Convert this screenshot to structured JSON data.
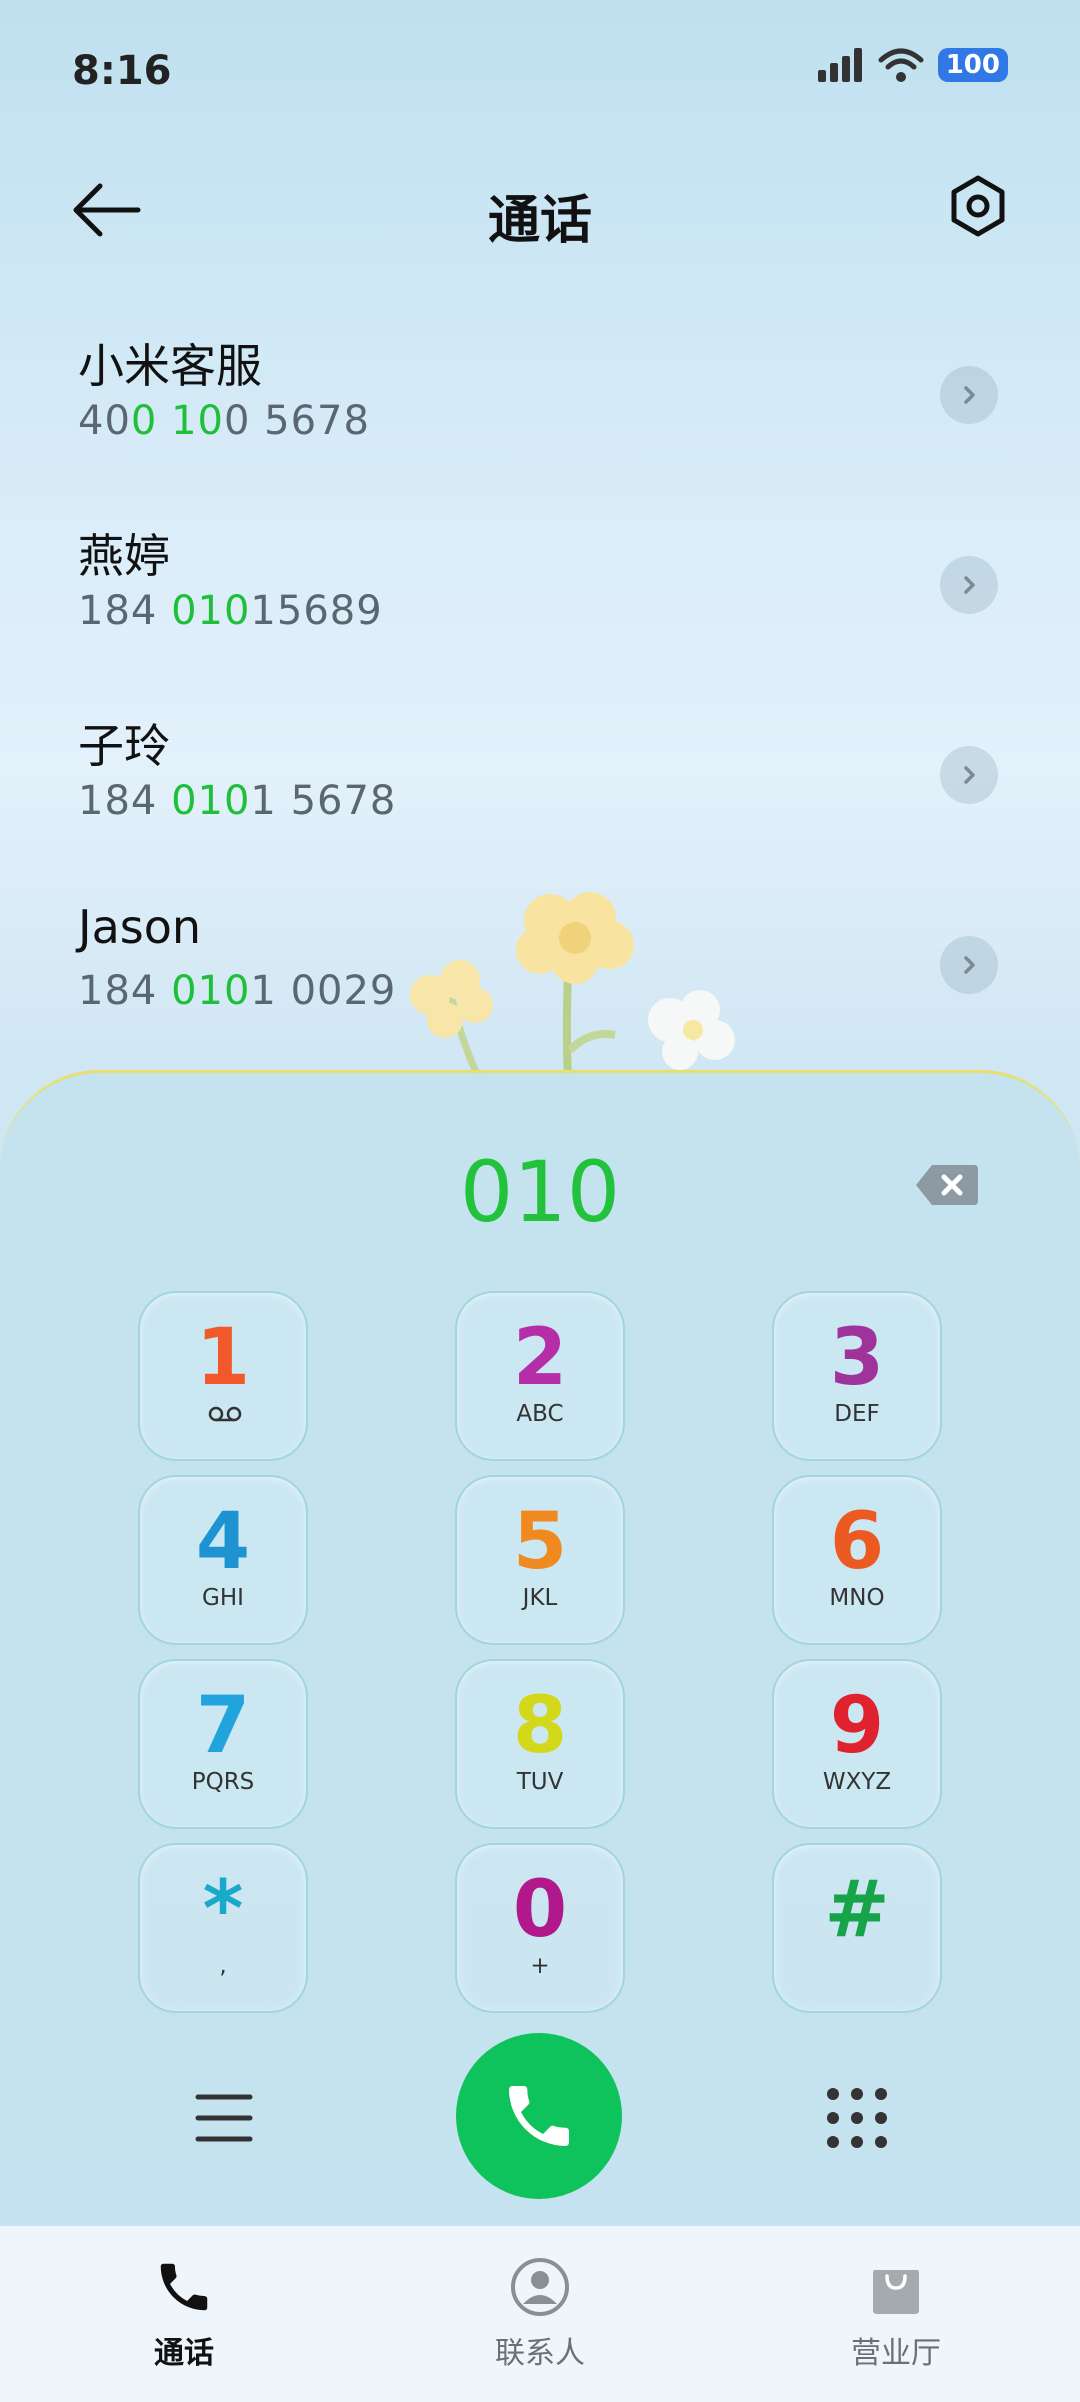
{
  "status_bar": {
    "time": "8:16",
    "battery": "100"
  },
  "header": {
    "title": "通话"
  },
  "contacts": [
    {
      "name": "小米客服",
      "number_parts": [
        "40",
        "0",
        " ",
        "10",
        "0 5678"
      ]
    },
    {
      "name": "燕婷",
      "number_parts": [
        "184 ",
        "010",
        "15689",
        "",
        ""
      ]
    },
    {
      "name": "子玲",
      "number_parts": [
        "184 ",
        "010",
        "1 5678",
        "",
        ""
      ]
    },
    {
      "name": "Jason",
      "number_parts": [
        "184 ",
        "010",
        "1 0029",
        "",
        ""
      ]
    }
  ],
  "dialer": {
    "input": "010",
    "keys": [
      {
        "digit": "1",
        "letters": "",
        "color": "#f1592a"
      },
      {
        "digit": "2",
        "letters": "ABC",
        "color": "#b52ea8"
      },
      {
        "digit": "3",
        "letters": "DEF",
        "color": "#a0339a"
      },
      {
        "digit": "4",
        "letters": "GHI",
        "color": "#1d93d1"
      },
      {
        "digit": "5",
        "letters": "JKL",
        "color": "#f08a1e"
      },
      {
        "digit": "6",
        "letters": "MNO",
        "color": "#ec5a22"
      },
      {
        "digit": "7",
        "letters": "PQRS",
        "color": "#21a3dd"
      },
      {
        "digit": "8",
        "letters": "TUV",
        "color": "#d3d91a"
      },
      {
        "digit": "9",
        "letters": "WXYZ",
        "color": "#e0222f"
      },
      {
        "digit": "*",
        "letters": ",",
        "color": "#1aa9c9"
      },
      {
        "digit": "0",
        "letters": "+",
        "color": "#b0188c"
      },
      {
        "digit": "#",
        "letters": "",
        "color": "#16a34a"
      }
    ]
  },
  "bottom_nav": [
    {
      "label": "通话",
      "icon": "phone-icon",
      "active": true
    },
    {
      "label": "联系人",
      "icon": "person-icon",
      "active": false
    },
    {
      "label": "营业厅",
      "icon": "shopping-bag-icon",
      "active": false
    }
  ]
}
